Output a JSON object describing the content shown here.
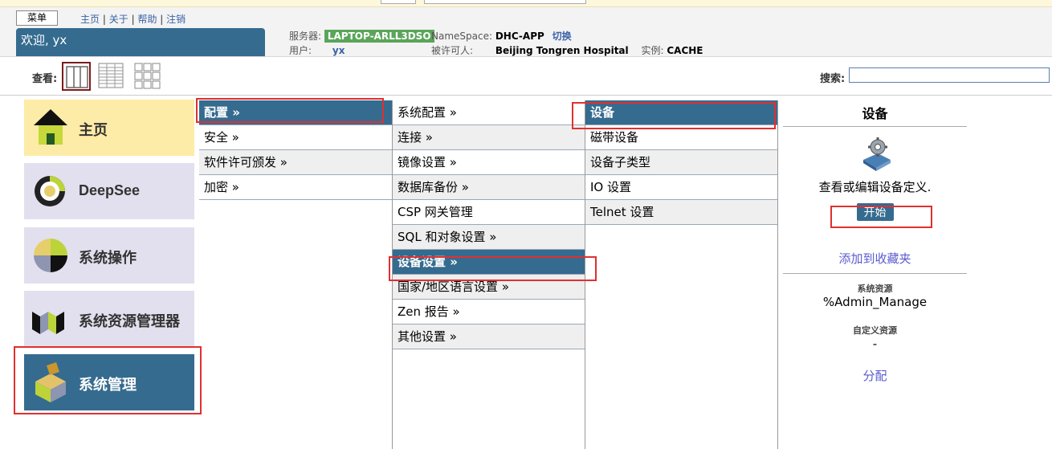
{
  "topbar": {
    "menu_label": "菜单",
    "links": [
      "主页",
      "关于",
      "帮助",
      "注销"
    ],
    "sep": "|"
  },
  "welcome": "欢迎, yx",
  "info": {
    "server_label": "服务器:",
    "server_value": "LAPTOP-ARLL3DSO",
    "namespace_label": "NameSpace:",
    "namespace_value": "DHC-APP",
    "switch_label": "切换",
    "user_label": "用户:",
    "user_value": "yx",
    "licensee_label": "被许可人:",
    "licensee_value": "Beijing Tongren Hospital",
    "instance_label": "实例:",
    "instance_value": "CACHE"
  },
  "view": {
    "label": "查看:"
  },
  "search": {
    "label": "搜索:",
    "value": ""
  },
  "tiles": [
    {
      "label": "主页",
      "icon": "home-icon"
    },
    {
      "label": "DeepSee",
      "icon": "deepsee-icon"
    },
    {
      "label": "系统操作",
      "icon": "operations-icon"
    },
    {
      "label": "系统资源管理器",
      "icon": "explorer-icon"
    },
    {
      "label": "系统管理",
      "icon": "administration-icon"
    }
  ],
  "col1": [
    "配置 »",
    "安全 »",
    "软件许可颁发 »",
    "加密 »"
  ],
  "col2": [
    "系统配置 »",
    "连接 »",
    "镜像设置 »",
    "数据库备份 »",
    "CSP 网关管理",
    "SQL 和对象设置 »",
    "设备设置 »",
    "国家/地区语言设置 »",
    "Zen 报告 »",
    "其他设置 »"
  ],
  "col3": [
    "设备",
    "磁带设备",
    "设备子类型",
    "IO 设置",
    "Telnet 设置"
  ],
  "detail": {
    "title": "设备",
    "desc": "查看或编辑设备定义.",
    "start": "开始",
    "favorite": "添加到收藏夹",
    "sys_res_label": "系统资源",
    "sys_res_value": "%Admin_Manage",
    "custom_res_label": "自定义资源",
    "custom_res_value": "-",
    "assign": "分配"
  },
  "colors": {
    "accent": "#356b8f",
    "highlight_box": "#e03030",
    "tile_home": "#fdeba8",
    "tile": "#e2e0ee"
  }
}
